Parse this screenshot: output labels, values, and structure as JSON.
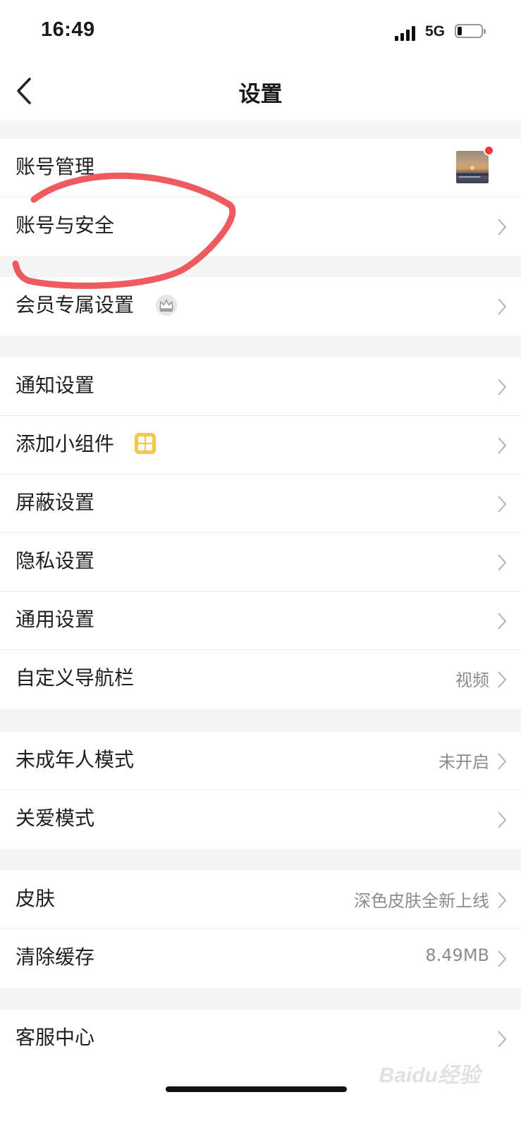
{
  "status_bar": {
    "time": "16:49",
    "network": "5G",
    "signal_bars": 4,
    "battery_level_percent": 20
  },
  "nav": {
    "title": "设置",
    "back_icon": "chevron-left-icon"
  },
  "groups": [
    {
      "rows": [
        {
          "label": "账号管理",
          "extra": "avatar-thumbnail",
          "notification_dot": true
        },
        {
          "label": "账号与安全",
          "annotated": true
        }
      ]
    },
    {
      "rows": [
        {
          "label": "会员专属设置",
          "icon": "crown-icon"
        }
      ]
    },
    {
      "rows": [
        {
          "label": "通知设置"
        },
        {
          "label": "添加小组件",
          "icon": "widget-icon"
        },
        {
          "label": "屏蔽设置"
        },
        {
          "label": "隐私设置"
        },
        {
          "label": "通用设置"
        },
        {
          "label": "自定义导航栏",
          "value": "视频"
        }
      ]
    },
    {
      "rows": [
        {
          "label": "未成年人模式",
          "value": "未开启"
        },
        {
          "label": "关爱模式"
        }
      ]
    },
    {
      "rows": [
        {
          "label": "皮肤",
          "value": "深色皮肤全新上线"
        },
        {
          "label": "清除缓存",
          "value": "8.49MB"
        }
      ]
    },
    {
      "rows": [
        {
          "label": "客服中心"
        }
      ]
    }
  ],
  "colors": {
    "background": "#f5f5f5",
    "row_background": "#ffffff",
    "annotation_stroke": "#ee5a5e",
    "notification_dot": "#f5313a",
    "widget_icon": "#f2c94c",
    "secondary_text": "#8c8c8c"
  },
  "watermark": "Baidu经验"
}
